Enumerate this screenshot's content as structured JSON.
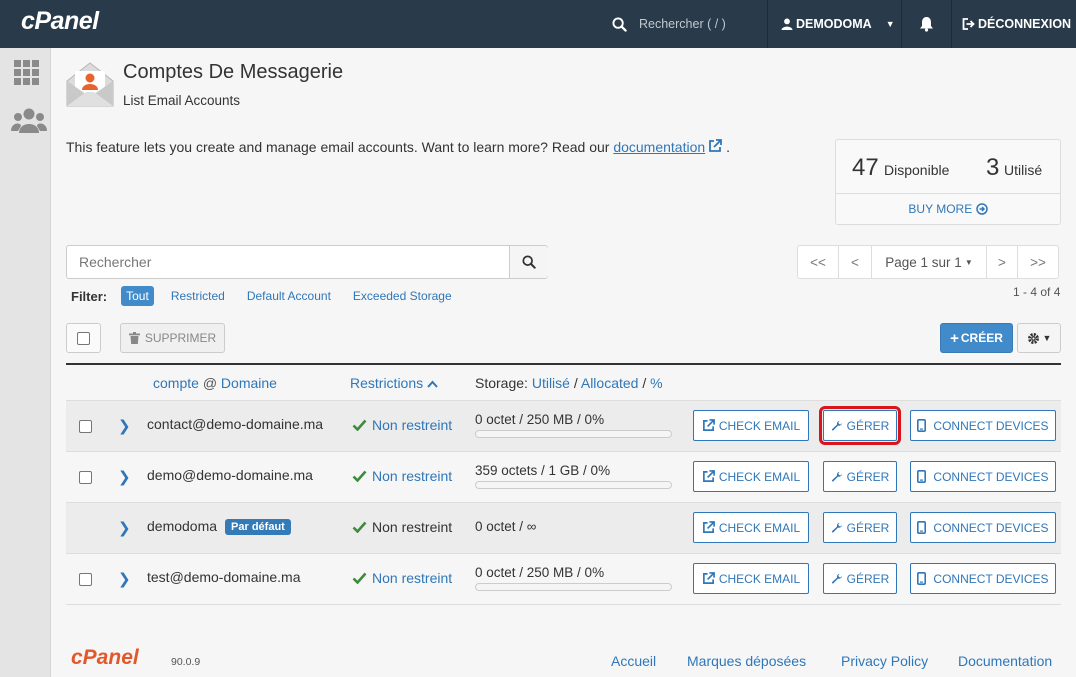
{
  "topbar": {
    "logo": "cPanel",
    "search_placeholder": "Rechercher ( / )",
    "username": "DEMODOMA",
    "logout_label": "DÉCONNEXION"
  },
  "page": {
    "title": "Comptes De Messagerie",
    "subtitle": "List Email Accounts",
    "intro_text": "This feature lets you create and manage email accounts. Want to learn more? Read our ",
    "intro_link": "documentation",
    "intro_end": "."
  },
  "stats": {
    "available_count": "47",
    "available_label": "Disponible",
    "used_count": "3",
    "used_label": "Utilisé",
    "buy_more": "BUY MORE"
  },
  "search": {
    "placeholder": "Rechercher"
  },
  "pagination": {
    "first": "<<",
    "prev": "<",
    "page_label": "Page 1 sur 1",
    "next": ">",
    "last": ">>",
    "range": "1 - 4 of 4"
  },
  "filter": {
    "label": "Filter:",
    "options": [
      "Tout",
      "Restricted",
      "Default Account",
      "Exceeded Storage"
    ],
    "active": "Tout"
  },
  "actions": {
    "delete_label": "SUPPRIMER",
    "create_label": "CRÉER"
  },
  "table": {
    "header": {
      "account": "compte",
      "at": "@",
      "domain": "Domaine",
      "restrictions": "Restrictions",
      "storage_prefix": "Storage:",
      "used": "Utilisé",
      "sep1": "/",
      "allocated": "Allocated",
      "sep2": "/",
      "percent": "%"
    },
    "button_labels": {
      "check": "CHECK EMAIL",
      "manage": "GÉRER",
      "connect": "CONNECT DEVICES"
    },
    "rows": [
      {
        "account": "contact@demo-domaine.ma",
        "badge": "",
        "restriction": "Non restreint",
        "restriction_is_link": true,
        "storage": "0 octet / 250 MB / 0%",
        "usage_fraction": 0.0,
        "has_bar": true,
        "has_checkbox": true,
        "manage_highlighted": true
      },
      {
        "account": "demo@demo-domaine.ma",
        "badge": "",
        "restriction": "Non restreint",
        "restriction_is_link": true,
        "storage": "359 octets / 1 GB / 0%",
        "usage_fraction": 0.0,
        "has_bar": true,
        "has_checkbox": true,
        "manage_highlighted": false
      },
      {
        "account": "demodoma",
        "badge": "Par défaut",
        "restriction": "Non restreint",
        "restriction_is_link": false,
        "storage": "0 octet / ∞",
        "usage_fraction": 0.0,
        "has_bar": false,
        "has_checkbox": false,
        "manage_highlighted": false
      },
      {
        "account": "test@demo-domaine.ma",
        "badge": "",
        "restriction": "Non restreint",
        "restriction_is_link": true,
        "storage": "0 octet / 250 MB / 0%",
        "usage_fraction": 0.0,
        "has_bar": true,
        "has_checkbox": true,
        "manage_highlighted": false
      }
    ]
  },
  "footer": {
    "logo": "cPanel",
    "version": "90.0.9",
    "links": [
      "Accueil",
      "Marques déposées",
      "Privacy Policy",
      "Documentation"
    ]
  },
  "colors": {
    "topbar": "#293a4a",
    "link": "#2f77b9",
    "primary_button": "#428bca",
    "highlight_border": "#d9141a",
    "footer_logo": "#e3582b",
    "check_green": "#3d8b3d"
  }
}
